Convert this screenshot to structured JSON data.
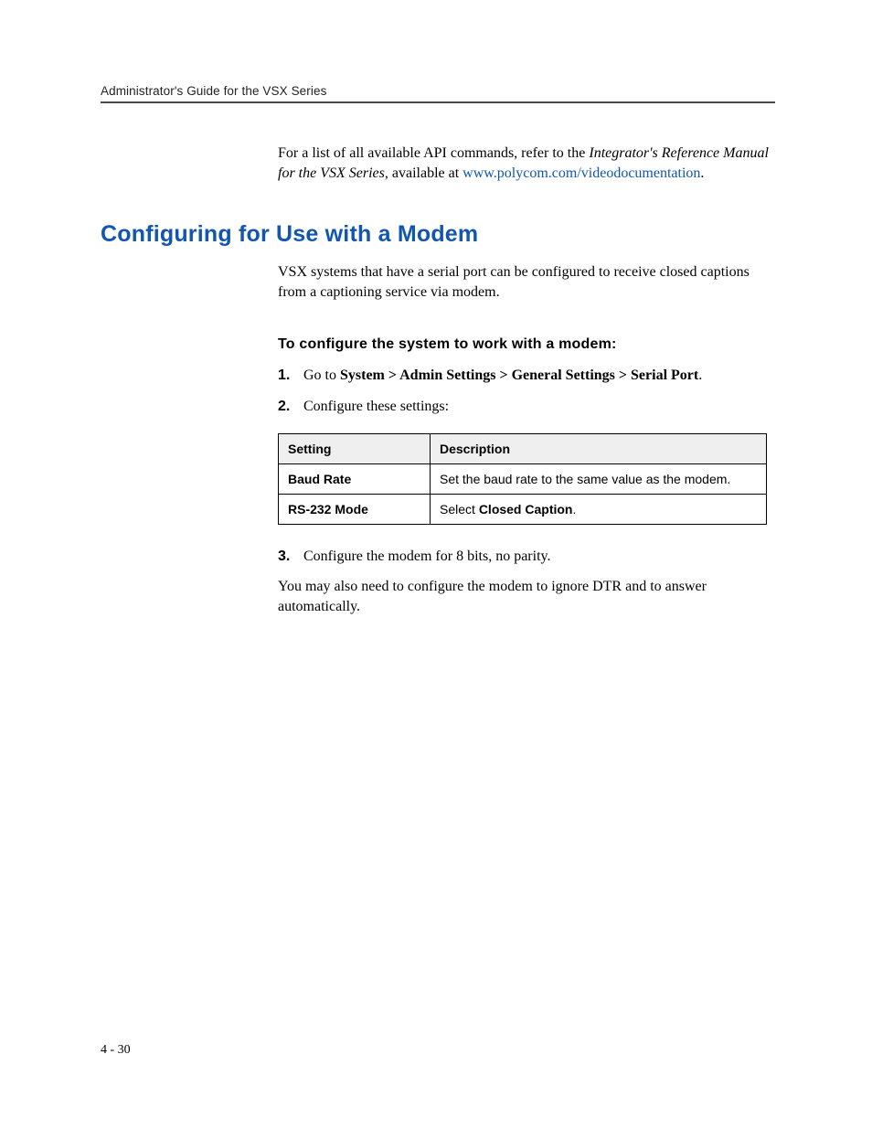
{
  "header": {
    "running_title": "Administrator's Guide for the VSX Series"
  },
  "intro": {
    "text_before_italic": "For a list of all available API commands, refer to the ",
    "italic_title": "Integrator's Reference Manual for the VSX Series",
    "text_after_italic": ", available at ",
    "link_text": "www.polycom.com/videodocumentation",
    "period": "."
  },
  "section": {
    "heading": "Configuring for Use with a Modem",
    "para1": "VSX systems that have a serial port can be configured to receive closed captions from a captioning service via modem.",
    "sub_heading": "To configure the system to work with a modem:"
  },
  "steps": {
    "s1_num": "1.",
    "s1_pre": "Go to ",
    "s1_bold": "System > Admin Settings > General Settings > Serial Port",
    "s1_post": ".",
    "s2_num": "2.",
    "s2_text": "Configure these settings:",
    "s3_num": "3.",
    "s3_text": "Configure the modem for 8 bits, no parity."
  },
  "table": {
    "header_setting": "Setting",
    "header_description": "Description",
    "row1_setting": "Baud Rate",
    "row1_desc": "Set the baud rate to the same value as the modem.",
    "row2_setting": "RS-232 Mode",
    "row2_desc_pre": "Select ",
    "row2_desc_bold": "Closed Caption",
    "row2_desc_post": "."
  },
  "closing": {
    "text": "You may also need to configure the modem to ignore DTR and to answer automatically."
  },
  "footer": {
    "page_number": "4 - 30"
  }
}
